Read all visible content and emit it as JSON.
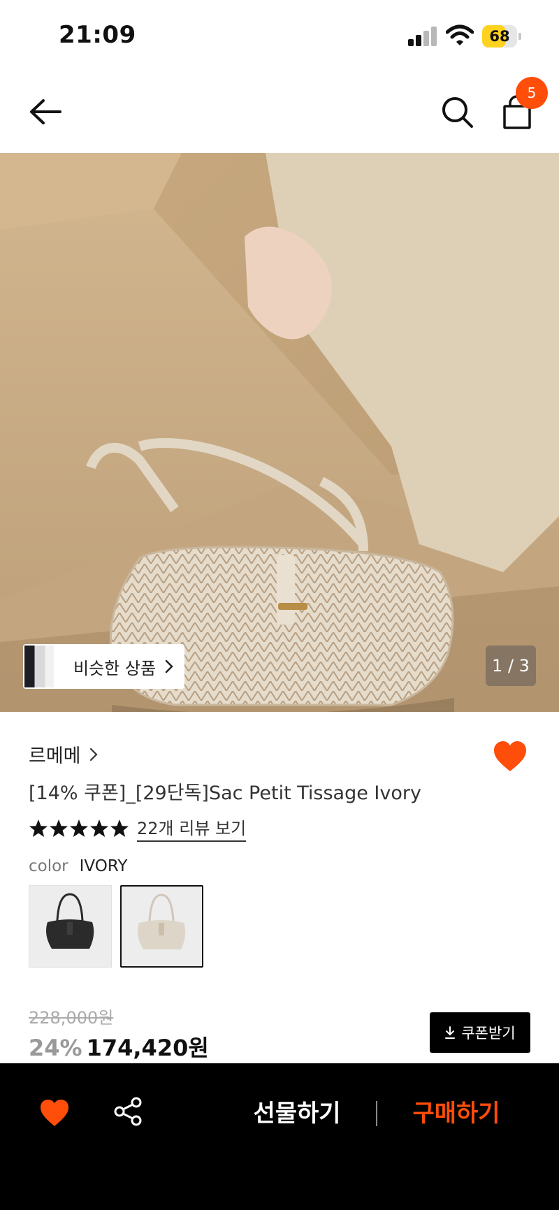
{
  "status_bar": {
    "time": "21:09",
    "battery_level": "68",
    "battery_fraction": 0.68
  },
  "header": {
    "cart_count": "5",
    "icons": [
      "back-arrow-icon",
      "search-icon",
      "shopping-bag-icon"
    ]
  },
  "gallery": {
    "similar_label": "비슷한 상품",
    "page_indicator": "1 / 3"
  },
  "product": {
    "brand": "르메메",
    "title": "[14% 쿠폰]_[29단독]Sac Petit Tissage Ivory",
    "rating_stars": 5,
    "review_link": "22개 리뷰 보기",
    "option_label": "color",
    "option_value": "IVORY",
    "swatches": [
      "black",
      "ivory"
    ],
    "selected_swatch": "ivory",
    "wishlisted": true
  },
  "price": {
    "original": "228,000원",
    "discount_rate": "24%",
    "sale": "174,420원",
    "coupon_label": "쿠폰받기"
  },
  "bottom_bar": {
    "gift_label": "선물하기",
    "buy_label": "구매하기"
  },
  "colors": {
    "accent": "#ff4d0a",
    "battery": "#ffd21f",
    "bottom_bar_bg": "#000000"
  }
}
